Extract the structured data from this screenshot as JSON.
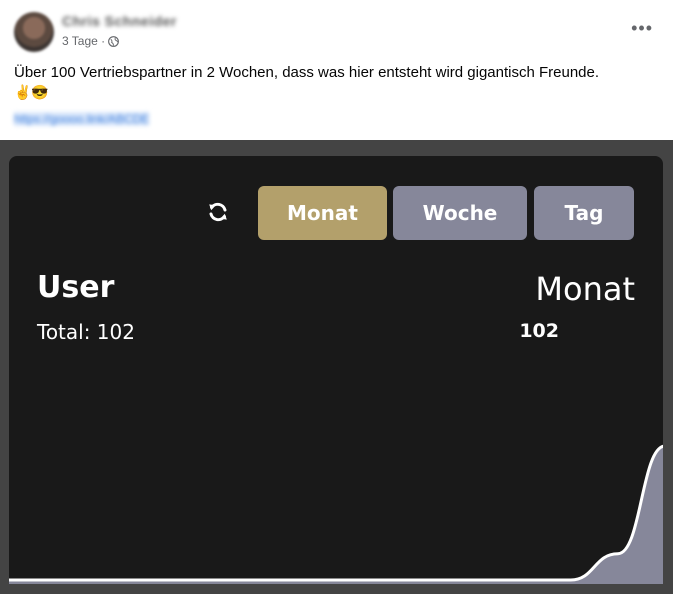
{
  "post": {
    "author": "Chris Schneider",
    "time": "3 Tage ·",
    "more": "•••",
    "text": "Über 100 Vertriebspartner in 2 Wochen, dass was hier entsteht wird gigantisch Freunde.",
    "emojis": "✌😎",
    "link": "https://goooo.link/ABCDE"
  },
  "app": {
    "tabs": {
      "monat": "Monat",
      "woche": "Woche",
      "tag": "Tag"
    },
    "user_title": "User",
    "user_total": "Total: 102",
    "period_title": "Monat",
    "period_count": "102",
    "colors": {
      "card": "#191919",
      "active_tab": "#b3a06b",
      "inactive_tab": "#86879a",
      "area": "#86879a"
    }
  },
  "chart_data": {
    "type": "area",
    "x": [
      0,
      1,
      2,
      3,
      4,
      5,
      6,
      7,
      8,
      9,
      10,
      11,
      12,
      13,
      14
    ],
    "values": [
      0,
      0,
      0,
      0,
      0,
      0,
      0,
      0,
      0,
      0,
      0,
      0,
      0,
      20,
      102
    ],
    "ylim": [
      0,
      102
    ],
    "grid": false,
    "legend": "none"
  }
}
